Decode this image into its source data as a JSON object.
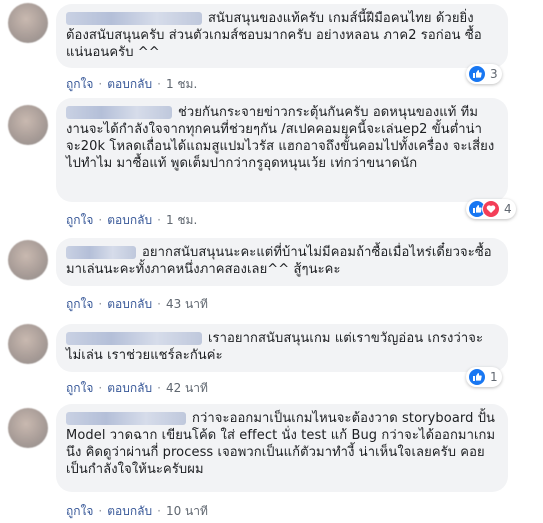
{
  "comments": [
    {
      "text": "สนับสนุนของแท้ครับ เกมส์นี้ฝีมือคนไทย ด้วยยิ่งต้องสนับสนุนครับ ส่วนตัวเกมส์ชอบมากครับ อย่างหลอน ภาค2 รอก่อน ซื้อแน่นอนครับ ^^",
      "like_label": "ถูกใจ",
      "reply_label": "ตอบกลับ",
      "time": "1 ชม.",
      "reaction_count": "3",
      "reactions": [
        "like-icon"
      ]
    },
    {
      "text": "ช่วยกันกระจายข่าวกระตุ้นกันครับ อดหนุนของแท้ ทีมงานจะได้กำลังใจจากทุกคนที่ช่วยๆกัน /สเปคคอมยุคนี้จะเล่นep2 ขั้นต่ำน่าจะ20k โหลดเถื่อนได้แถมสูแปมไวรัส แฮกอาจถึงขั้นคอมไปทั้งเครื่อง จะเสี่ยงไปทำไม มาซื้อแท้ พูดเต็มปากว่ากรูอุดหนุนเว้ย เท่กว่าขนาดนัก",
      "like_label": "ถูกใจ",
      "reply_label": "ตอบกลับ",
      "time": "1 ชม.",
      "reaction_count": "4",
      "reactions": [
        "like-icon",
        "love-icon"
      ]
    },
    {
      "text": "อยากสนับสนุนนะคะแต่ที่บ้านไม่มีคอมถ้าซื้อเมื่อไหร่เดี๋ยวจะซื้อมาเล่นนะคะทั้งภาคหนึ่งภาคสองเลย^^ สู้ๆนะคะ",
      "like_label": "ถูกใจ",
      "reply_label": "ตอบกลับ",
      "time": "43 นาที",
      "reaction_count": "",
      "reactions": []
    },
    {
      "text": "เราอยากสนับสนุนเกม แต่เราขวัญอ่อน เกรงว่าจะไม่เล่น เราช่วยแชร์ละกันค่ะ",
      "like_label": "ถูกใจ",
      "reply_label": "ตอบกลับ",
      "time": "42 นาที",
      "reaction_count": "1",
      "reactions": [
        "like-icon"
      ]
    },
    {
      "text": "กว่าจะออกมาเป็นเกมไหนจะต้องวาด storyboard ปั้น Model วาดฉาก เขียนโค้ด ใส่ effect นั่ง test แก้ Bug กว่าจะได้ออกมาเกมนึง คิดดูว่าผ่านกี่ process เจอพวกเป็นแก้ตัวมาทำงี้ น่าเห็นใจเลยครับ คอยเป็นกำลังใจให้นะครับผม",
      "like_label": "ถูกใจ",
      "reply_label": "ตอบกลับ",
      "time": "10 นาที",
      "reaction_count": "",
      "reactions": []
    }
  ]
}
